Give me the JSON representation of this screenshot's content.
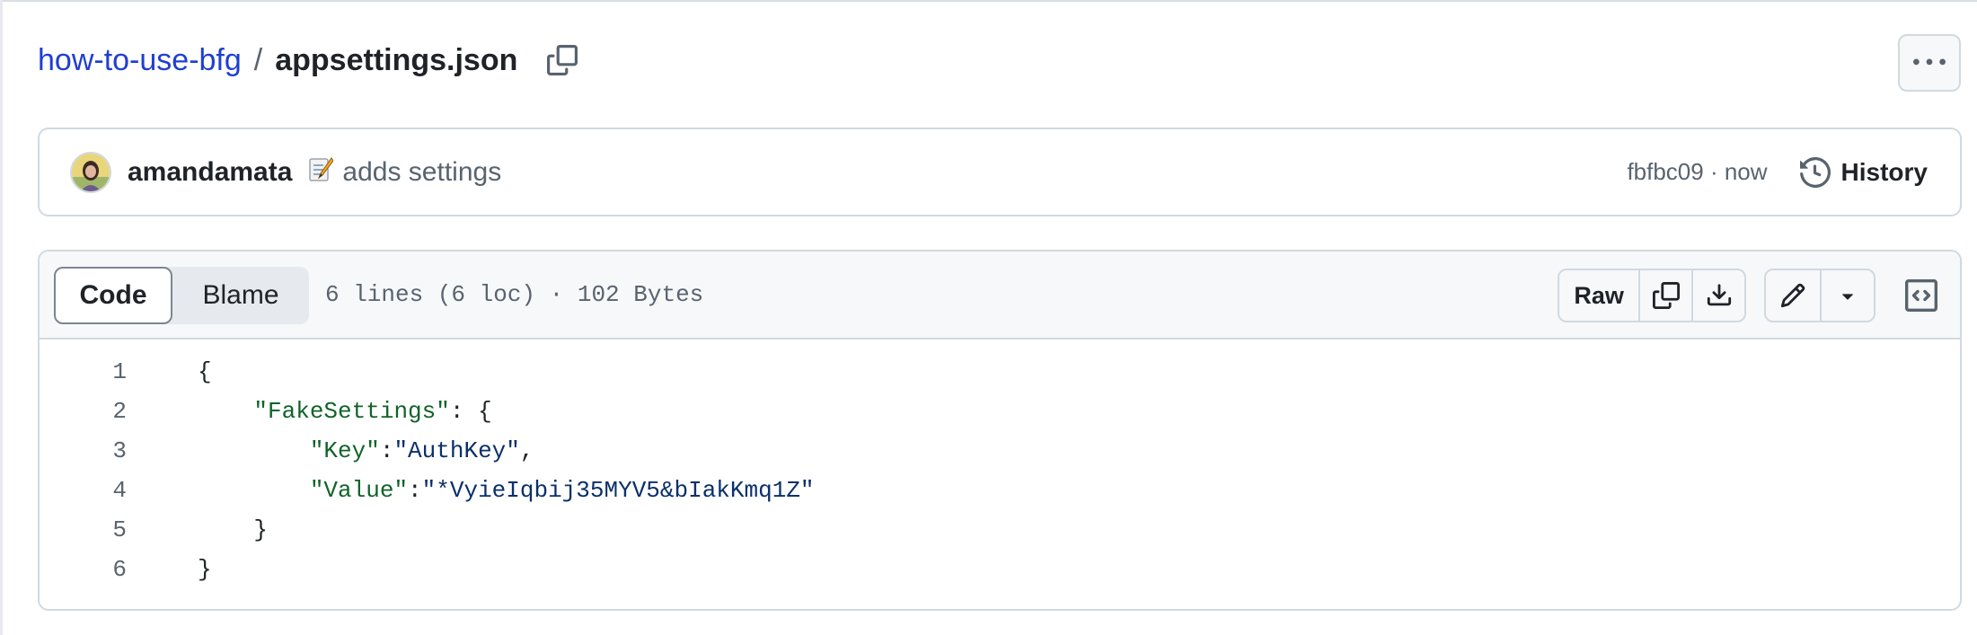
{
  "breadcrumb": {
    "repo": "how-to-use-bfg",
    "separator": "/",
    "file": "appsettings.json"
  },
  "commit": {
    "author": "amandamata",
    "message_icon": "memo-emoji",
    "message": "adds settings",
    "sha_time": "fbfbc09 · now",
    "history_label": "History"
  },
  "file_header": {
    "tabs": [
      {
        "label": "Code",
        "selected": true
      },
      {
        "label": "Blame",
        "selected": false
      }
    ],
    "info": "6 lines (6 loc) · 102 Bytes",
    "raw_label": "Raw"
  },
  "icons": {
    "copy_path": "copy-icon",
    "more": "kebab-horizontal-icon",
    "history": "history-icon",
    "copy_raw": "copy-icon",
    "download": "download-icon",
    "edit": "pencil-icon",
    "dropdown": "triangle-down-icon",
    "symbols": "code-square-icon"
  },
  "code_lines": [
    {
      "number": "1",
      "indent": "",
      "tokens": [
        {
          "t": "{",
          "c": "plain"
        }
      ]
    },
    {
      "number": "2",
      "indent": "    ",
      "tokens": [
        {
          "t": "\"FakeSettings\"",
          "c": "key"
        },
        {
          "t": ": {",
          "c": "plain"
        }
      ]
    },
    {
      "number": "3",
      "indent": "        ",
      "tokens": [
        {
          "t": "\"Key\"",
          "c": "key"
        },
        {
          "t": ":",
          "c": "plain"
        },
        {
          "t": "\"AuthKey\"",
          "c": "str"
        },
        {
          "t": ",",
          "c": "plain"
        }
      ]
    },
    {
      "number": "4",
      "indent": "        ",
      "tokens": [
        {
          "t": "\"Value\"",
          "c": "key"
        },
        {
          "t": ":",
          "c": "plain"
        },
        {
          "t": "\"*VyieIqbij35MYV5&bIakKmq1Z\"",
          "c": "str"
        }
      ]
    },
    {
      "number": "5",
      "indent": "    ",
      "tokens": [
        {
          "t": "}",
          "c": "plain"
        }
      ]
    },
    {
      "number": "6",
      "indent": "",
      "tokens": [
        {
          "t": "}",
          "c": "plain"
        }
      ]
    }
  ],
  "colors": {
    "link": "#1f3fd1",
    "json_key": "#116329",
    "json_string": "#0a3069",
    "border": "#d1d9e0",
    "muted": "#59636e"
  }
}
